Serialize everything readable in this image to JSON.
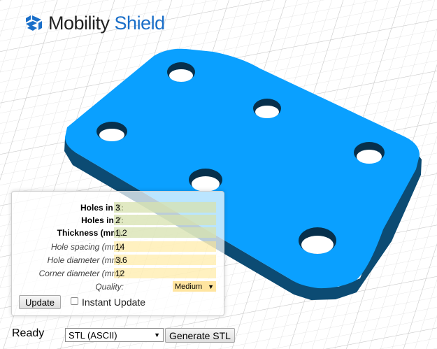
{
  "app": {
    "brand_word1": "Mobility",
    "brand_word2": "Shield",
    "brand_color": "#1a6fc9"
  },
  "model": {
    "color": "#0aa0ff",
    "side_color": "#0c4b73",
    "hole_shadow": "#07304c"
  },
  "params": [
    {
      "label": "Holes in X:",
      "value": "3",
      "kind": "required"
    },
    {
      "label": "Holes in Y:",
      "value": "2",
      "kind": "required"
    },
    {
      "label": "Thickness (mm):",
      "value": "1.2",
      "kind": "required"
    },
    {
      "label": "Hole spacing (mm):",
      "value": "14",
      "kind": "optional"
    },
    {
      "label": "Hole diameter (mm):",
      "value": "3.6",
      "kind": "optional"
    },
    {
      "label": "Corner diameter (mm):",
      "value": "12",
      "kind": "optional"
    }
  ],
  "quality": {
    "label": "Quality:",
    "value": "Medium"
  },
  "controls": {
    "update_label": "Update",
    "instant_label": "Instant Update",
    "instant_checked": false
  },
  "footer": {
    "status": "Ready",
    "format_value": "STL (ASCII)",
    "generate_label": "Generate STL"
  },
  "icons": {
    "dropdown": "▼"
  }
}
